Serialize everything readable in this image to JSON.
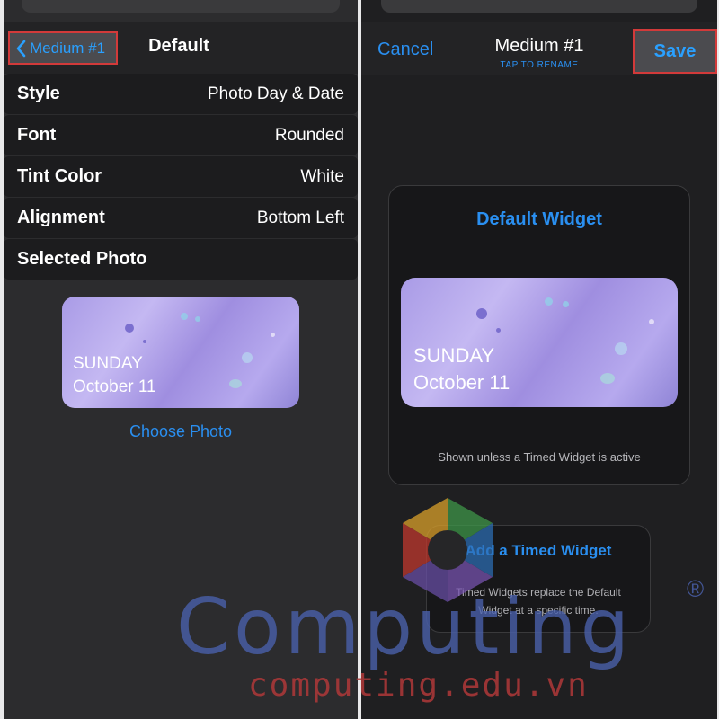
{
  "left": {
    "back_label": "Medium #1",
    "title": "Default",
    "rows": [
      {
        "label": "Style",
        "value": "Photo Day & Date"
      },
      {
        "label": "Font",
        "value": "Rounded"
      },
      {
        "label": "Tint Color",
        "value": "White"
      },
      {
        "label": "Alignment",
        "value": "Bottom Left"
      },
      {
        "label": "Selected Photo",
        "value": ""
      }
    ],
    "preview_day": "SUNDAY",
    "preview_date": "October 11",
    "choose_photo": "Choose Photo"
  },
  "right": {
    "cancel_label": "Cancel",
    "title": "Medium #1",
    "subtitle": "TAP TO RENAME",
    "save_label": "Save",
    "default_widget_title": "Default Widget",
    "preview_day": "SUNDAY",
    "preview_date": "October 11",
    "default_caption": "Shown unless a Timed Widget is active",
    "timed_title": "Add a Timed Widget",
    "timed_desc": "Timed Widgets replace the Default Widget at a specific time."
  },
  "watermark": {
    "brand": "Computing",
    "reg": "®",
    "url": "computing.edu.vn"
  },
  "colors": {
    "accent_blue": "#2a8ff0",
    "highlight_red": "#d23a3a",
    "panel_bg": "#2c2c2e",
    "row_bg": "#1c1c1e"
  }
}
